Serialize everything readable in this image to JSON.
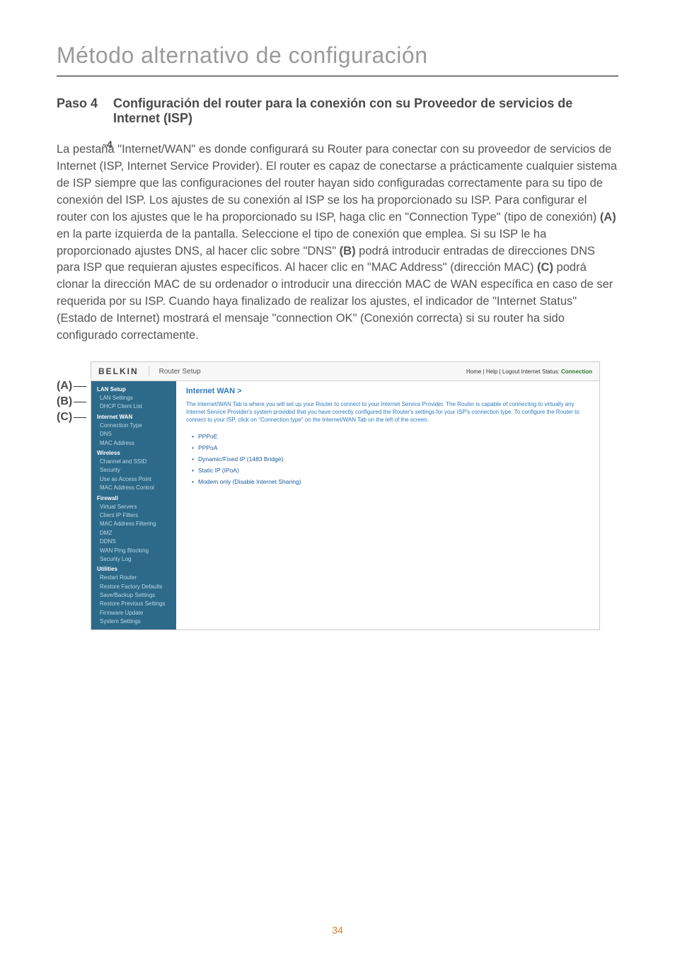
{
  "chapter_title": "Método alternativo de configuración",
  "step": {
    "label": "Paso 4",
    "title": "Configuración del router para la conexión con su Proveedor de servicios de Internet (ISP)"
  },
  "floating_marker": "4",
  "body": {
    "p1a": "La pestaña \"Internet/WAN\" es donde configurará su Router para conectar con su proveedor de servicios de Internet (ISP, Internet Service Provider). El router es capaz de conectarse a prácticamente cualquier sistema de ISP siempre que las configuraciones del router hayan sido configuradas correctamente para su tipo de conexión del ISP. Los ajustes de su conexión al ISP se los ha proporcionado su ISP. Para configurar el router con los ajustes que le ha proporcionado su ISP, haga clic en \"Connection Type\" (tipo de conexión) ",
    "bA": "(A)",
    "p1b": " en la parte izquierda de la pantalla. Seleccione el tipo de conexión que emplea. Si su ISP le ha proporcionado ajustes DNS, al hacer clic sobre \"DNS\" ",
    "bB": "(B)",
    "p1c": " podrá introducir entradas de direcciones DNS para ISP que requieran ajustes específicos. Al hacer clic en \"MAC Address\" (dirección MAC) ",
    "bC": "(C)",
    "p1d": " podrá clonar la dirección MAC de su ordenador o introducir una dirección MAC de WAN específica en caso de ser requerida por su ISP. Cuando haya finalizado de realizar los ajustes, el indicador de \"Internet Status\" (Estado de Internet) mostrará el mensaje \"connection OK\" (Conexión correcta) si su router ha sido configurado correctamente."
  },
  "callouts": {
    "a": "(A)",
    "b": "(B)",
    "c": "(C)"
  },
  "router": {
    "logo": "BELKIN",
    "setup_label": "Router Setup",
    "header_links": "Home | Help | Logout   Internet Status: ",
    "status_word": "Connection",
    "panel_heading": "Internet WAN >",
    "panel_text": "The Internet/WAN Tab is where you will set up your Router to connect to your Internet Service Provider. The Router is capable of connecting to virtually any Internet Service Provider's system provided that you have correctly configured the Router's settings for your ISP's connection type. To configure the Router to connect to your ISP, click on \"Connection type\" on the Internet/WAN Tab on the left of the screen.",
    "options": [
      "PPPoE",
      "PPPoA",
      "Dynamic/Fixed IP (1483 Bridge)",
      "Static IP (IPoA)",
      "Modem only (Disable Internet Sharing)"
    ],
    "sidebar": {
      "s1": "LAN Setup",
      "s1_items": [
        "LAN Settings",
        "DHCP Client List"
      ],
      "s2": "Internet WAN",
      "s2_items": [
        "Connection Type",
        "DNS",
        "MAC Address"
      ],
      "s3": "Wireless",
      "s3_items": [
        "Channel and SSID",
        "Security",
        "Use as Access Point",
        "MAC Address Control"
      ],
      "s4": "Firewall",
      "s4_items": [
        "Virtual Servers",
        "Client IP Filters",
        "MAC Address Filtering",
        "DMZ",
        "DDNS",
        "WAN Ping Blocking",
        "Security Log"
      ],
      "s5": "Utilities",
      "s5_items": [
        "Restart Router",
        "Restore Factory Defaults",
        "Save/Backup Settings",
        "Restore Previous Settings",
        "Firmware Update",
        "System Settings"
      ]
    }
  },
  "page_number": "34"
}
